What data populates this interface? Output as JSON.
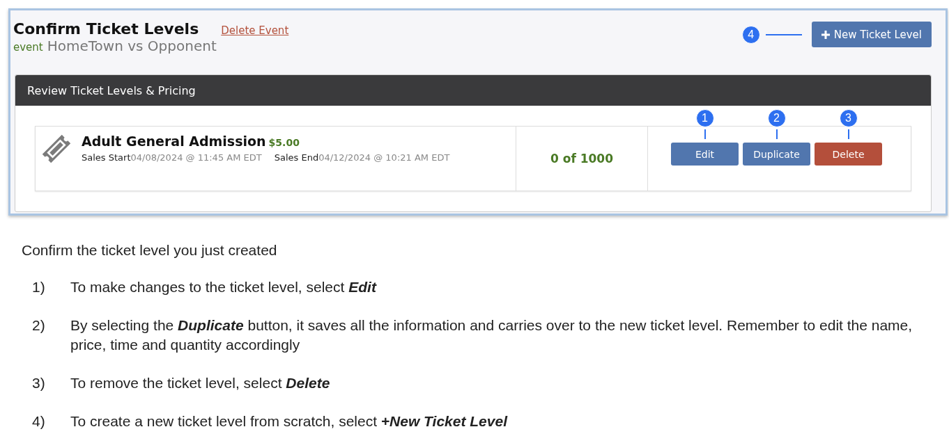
{
  "screenshot": {
    "title": "Confirm Ticket Levels",
    "delete_link": "Delete Event",
    "event_label": "event",
    "event_name": "HomeTown vs Opponent",
    "new_button": {
      "label": "New Ticket Level",
      "callout": "4"
    },
    "panel_title": "Review Ticket Levels & Pricing",
    "ticket_levels": [
      {
        "name": "Adult General Admission",
        "price": "$5.00",
        "start_label": "Sales Start",
        "start": "04/08/2024 @ 11:45 AM EDT",
        "end_label": "Sales End",
        "end": "04/12/2024 @ 10:21 AM EDT",
        "quantity": "0 of 1000",
        "actions": [
          {
            "label": "Edit",
            "kind": "primary",
            "callout": "1"
          },
          {
            "label": "Duplicate",
            "kind": "primary",
            "callout": "2"
          },
          {
            "label": "Delete",
            "kind": "danger",
            "callout": "3"
          }
        ]
      }
    ]
  },
  "intro": "Confirm the ticket level you just created",
  "steps": [
    {
      "number": "1)",
      "text": "To make changes to the ticket level, select **Edit**"
    },
    {
      "number": "2)",
      "text": "By selecting the **Duplicate** button, it saves all the information and carries over to the new ticket level. Remember to edit the name, price, time and quantity accordingly"
    },
    {
      "number": "3)",
      "text": "To remove the ticket level, select **Delete**"
    },
    {
      "number": "4)",
      "text": "To create a new ticket level from scratch, select **+New Ticket Level**"
    }
  ]
}
